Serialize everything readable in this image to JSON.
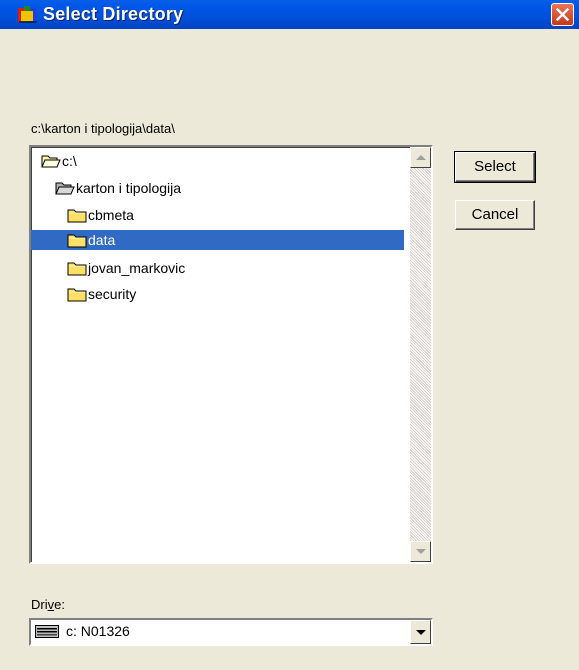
{
  "window": {
    "title": "Select Directory"
  },
  "current_path": "c:\\karton i tipologija\\data\\",
  "tree": [
    {
      "label": "c:\\",
      "icon": "open-folder-icon",
      "level": 0,
      "selected": false
    },
    {
      "label": "karton i tipologija",
      "icon": "open-folder-icon",
      "level": 1,
      "selected": false
    },
    {
      "label": "cbmeta",
      "icon": "folder-icon",
      "level": 2,
      "selected": false
    },
    {
      "label": "data",
      "icon": "folder-icon",
      "level": 2,
      "selected": true
    },
    {
      "label": "jovan_markovic",
      "icon": "folder-icon",
      "level": 2,
      "selected": false
    },
    {
      "label": "security",
      "icon": "folder-icon",
      "level": 2,
      "selected": false
    }
  ],
  "buttons": {
    "select": "Select",
    "cancel": "Cancel"
  },
  "drive": {
    "label_pre": "Dri",
    "label_u": "v",
    "label_post": "e:",
    "value": "c: N01326"
  },
  "colors": {
    "title_bar": "#0054E3",
    "selection": "#316AC5",
    "dialog_bg": "#ECE9D8"
  }
}
